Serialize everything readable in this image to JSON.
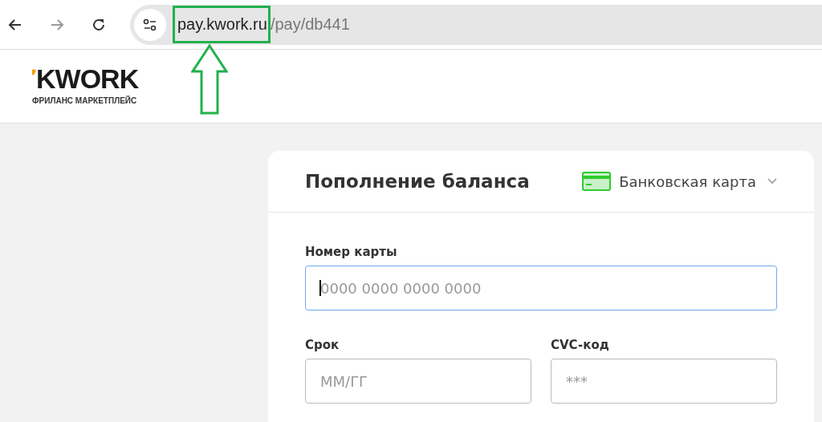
{
  "browser": {
    "url_host": "pay.kwork.ru",
    "url_path": "/pay/db441"
  },
  "header": {
    "logo": "KWORK",
    "tagline": "ФРИЛАНС МАРКЕТПЛЕЙС"
  },
  "card": {
    "title": "Пополнение баланса",
    "payment_method": "Банковская карта",
    "fields": [
      {
        "label": "Номер карты",
        "placeholder": "0000 0000 0000 0000",
        "focused": true
      },
      {
        "label": "Срок",
        "placeholder": "ММ/ГГ",
        "focused": false
      },
      {
        "label": "CVC-код",
        "placeholder": "***",
        "focused": false
      }
    ]
  }
}
